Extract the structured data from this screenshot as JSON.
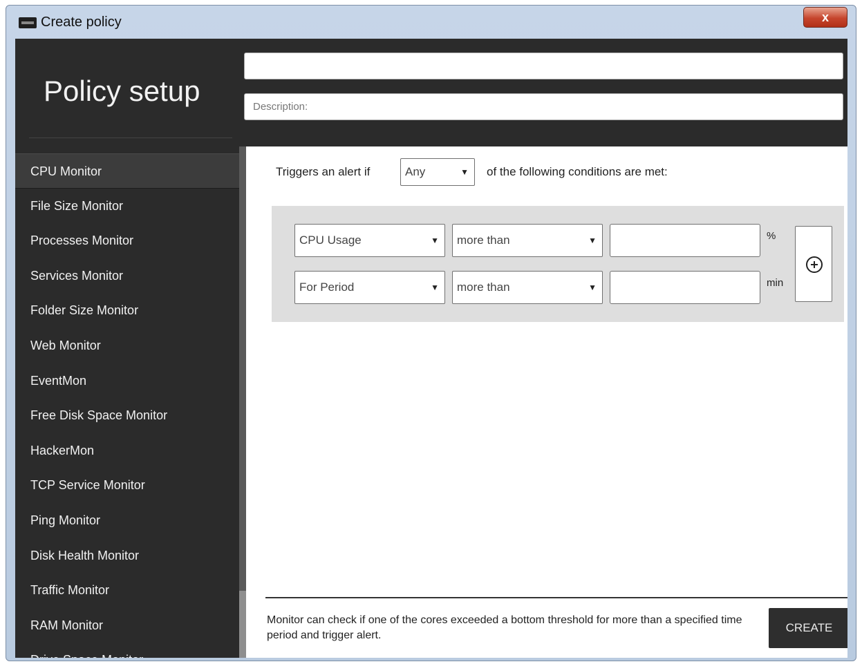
{
  "window": {
    "title": "Create policy",
    "close_label": "x"
  },
  "header": {
    "title": "Policy setup",
    "name_value": "",
    "description_placeholder": "Description:"
  },
  "sidebar": {
    "items": [
      {
        "label": "CPU Monitor",
        "active": true
      },
      {
        "label": "File Size Monitor"
      },
      {
        "label": "Processes Monitor"
      },
      {
        "label": "Services Monitor"
      },
      {
        "label": "Folder Size Monitor"
      },
      {
        "label": "Web Monitor"
      },
      {
        "label": "EventMon"
      },
      {
        "label": "Free Disk Space Monitor"
      },
      {
        "label": "HackerMon"
      },
      {
        "label": "TCP Service Monitor"
      },
      {
        "label": "Ping Monitor"
      },
      {
        "label": "Disk Health Monitor"
      },
      {
        "label": "Traffic  Monitor"
      },
      {
        "label": "RAM  Monitor"
      },
      {
        "label": "Drive Space Monitor"
      }
    ]
  },
  "main": {
    "trigger_prefix": "Triggers an alert if",
    "trigger_mode": "Any",
    "trigger_suffix": "of the following conditions are met:",
    "conditions": [
      {
        "metric": "CPU Usage",
        "operator": "more than",
        "value": "",
        "unit": "%"
      },
      {
        "metric": "For Period",
        "operator": "more than",
        "value": "",
        "unit": "min"
      }
    ],
    "footer_description": "Monitor can check if one of the cores exceeded a bottom threshold for more than a specified time period and trigger alert.",
    "create_label": "CREATE"
  }
}
